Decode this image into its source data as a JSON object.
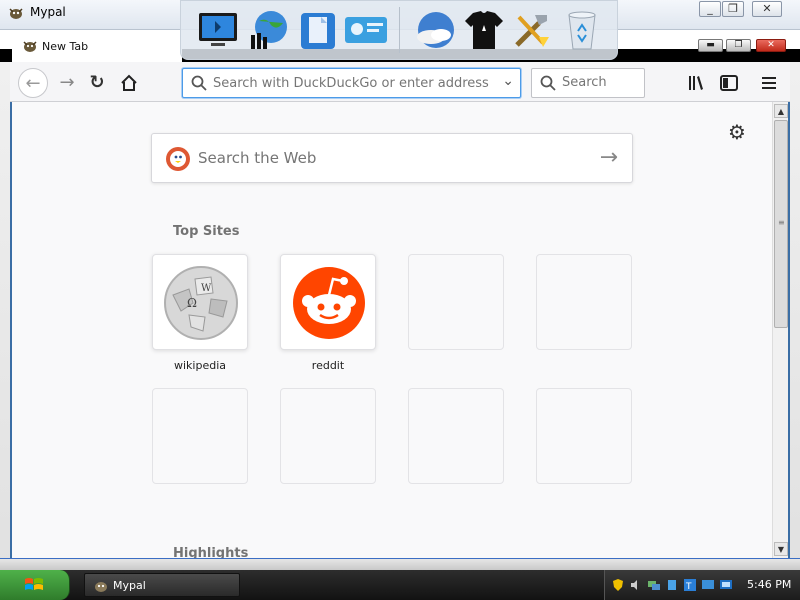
{
  "outer_window": {
    "title": "Mypal"
  },
  "tab": {
    "label": "New Tab"
  },
  "urlbar": {
    "placeholder": "Search with DuckDuckGo or enter address"
  },
  "searchbar": {
    "placeholder": "Search"
  },
  "content": {
    "web_search_placeholder": "Search the Web",
    "top_sites_title": "Top Sites",
    "highlights_title": "Highlights",
    "top_sites": [
      {
        "label": "wikipedia"
      },
      {
        "label": "reddit"
      }
    ]
  },
  "taskbar": {
    "task_label": "Mypal",
    "clock": "5:46 PM"
  },
  "colors": {
    "reddit": "#ff4500",
    "ddg": "#de5833",
    "urlbar_focus": "#4c9be8"
  }
}
